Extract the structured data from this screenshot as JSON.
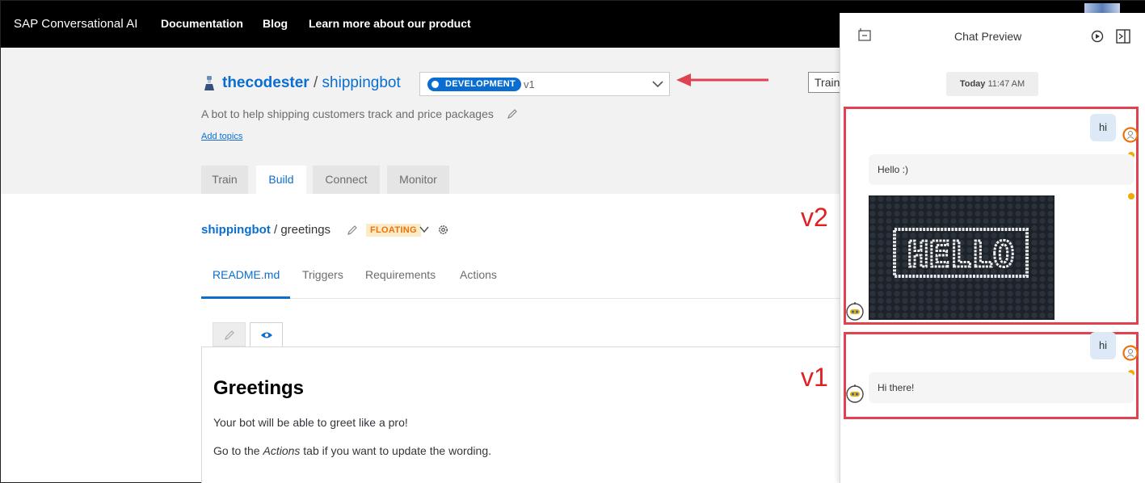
{
  "nav": {
    "brand": "SAP Conversational AI",
    "links": [
      "Documentation",
      "Blog",
      "Learn more about our product"
    ]
  },
  "bot": {
    "owner": "thecodester",
    "separator": "/",
    "name": "shippingbot",
    "description": "A bot to help shipping customers track and price packages",
    "add_topics": "Add topics",
    "environment": "DEVELOPMENT",
    "version": "v1",
    "train_button": "Train"
  },
  "main_tabs": [
    "Train",
    "Build",
    "Connect",
    "Monitor"
  ],
  "skill": {
    "bot_name": "shippingbot",
    "separator": "/",
    "name": "greetings",
    "type_badge": "FLOATING",
    "tabs": [
      "README.md",
      "Triggers",
      "Requirements",
      "Actions"
    ]
  },
  "readme": {
    "title": "Greetings",
    "line1": "Your bot will be able to greet like a pro!",
    "line2_pre": "Go to the ",
    "line2_em": "Actions",
    "line2_post": " tab if you want to update the wording."
  },
  "annotations": {
    "v2": "v2",
    "v1": "v1"
  },
  "chat": {
    "title": "Chat Preview",
    "date_day": "Today",
    "date_time": "11:47 AM",
    "v2": {
      "user_text": "hi",
      "bot_text": "Hello :)",
      "image_text": "HELLO"
    },
    "v1": {
      "user_text": "hi",
      "bot_text": "Hi there!"
    }
  },
  "colors": {
    "accent": "#0a6ed1",
    "floating_badge": "#e9730c",
    "annotation_red": "#e0434f",
    "info_dot": "#f0ab00"
  }
}
